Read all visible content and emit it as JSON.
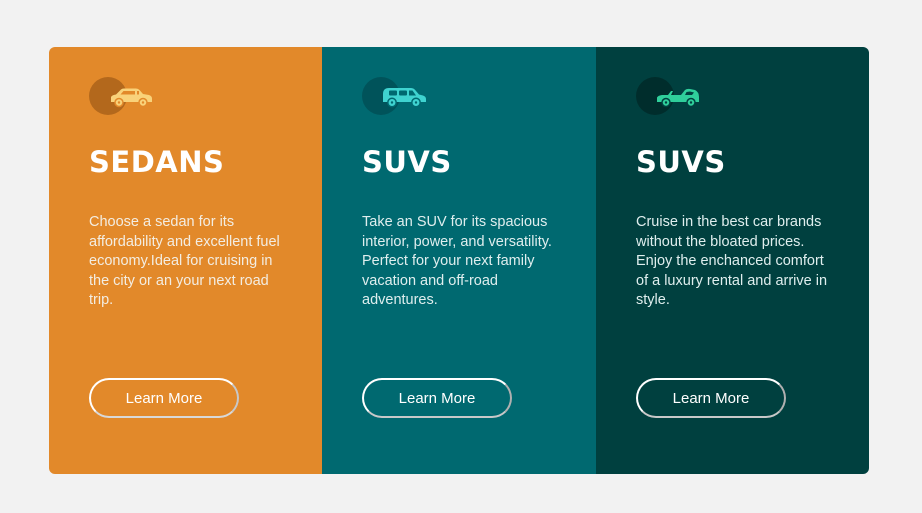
{
  "cards": [
    {
      "icon": "sedan-car-icon",
      "icon_color": "#f9d27a",
      "bg_color": "#e2892a",
      "title": "SEDANS",
      "text": "Choose a sedan for its affordability and excellent fuel economy.Ideal for cruising in the city or an your next road trip.",
      "button_label": "Learn More"
    },
    {
      "icon": "suv-car-icon",
      "icon_color": "#3fd3d0",
      "bg_color": "#006970",
      "title": "SUVS",
      "text": "Take an SUV for its spacious interior, power, and versatility. Perfect for your next family vacation and off-road adventures.",
      "button_label": "Learn More"
    },
    {
      "icon": "convertible-car-icon",
      "icon_color": "#2fcf9b",
      "bg_color": "#00403f",
      "title": "SUVS",
      "text": "Cruise in the best car brands without the bloated prices. Enjoy the enchanced comfort of a luxury rental and arrive in style.",
      "button_label": "Learn More"
    }
  ]
}
